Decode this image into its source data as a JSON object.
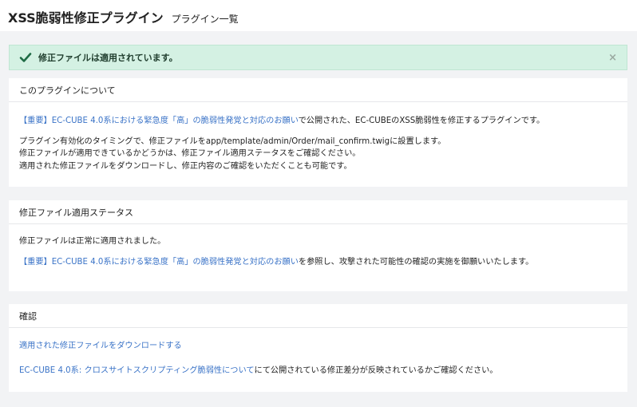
{
  "header": {
    "title": "XSS脆弱性修正プラグイン",
    "subtitle": "プラグイン一覧"
  },
  "alert": {
    "message": "修正ファイルは適用されています。",
    "close": "×"
  },
  "card_about": {
    "title": "このプラグインについて",
    "line1_link": "【重要】EC-CUBE 4.0系における緊急度「高」の脆弱性発覚と対応のお願い",
    "line1_text": "で公開された、EC-CUBEのXSS脆弱性を修正するプラグインです。",
    "line2": "プラグイン有効化のタイミングで、修正ファイルをapp/template/admin/Order/mail_confirm.twigに設置します。",
    "line3": "修正ファイルが適用できているかどうかは、修正ファイル適用ステータスをご確認ください。",
    "line4": "適用された修正ファイルをダウンロードし、修正内容のご確認をいただくことも可能です。"
  },
  "card_status": {
    "title": "修正ファイル適用ステータス",
    "line1": "修正ファイルは正常に適用されました。",
    "line2_link": "【重要】EC-CUBE 4.0系における緊急度「高」の脆弱性発覚と対応のお願い",
    "line2_text": "を参照し、攻撃された可能性の確認の実施を御願いいたします。"
  },
  "card_confirm": {
    "title": "確認",
    "download_link": "適用された修正ファイルをダウンロードする",
    "line2_link": "EC-CUBE 4.0系: クロスサイトスクリプティング脆弱性について",
    "line2_text": "にて公開されている修正差分が反映されているかご確認ください。"
  },
  "colors": {
    "link": "#3a73c7",
    "alert_bg": "#d4f1e3",
    "check": "#1f6b45"
  }
}
